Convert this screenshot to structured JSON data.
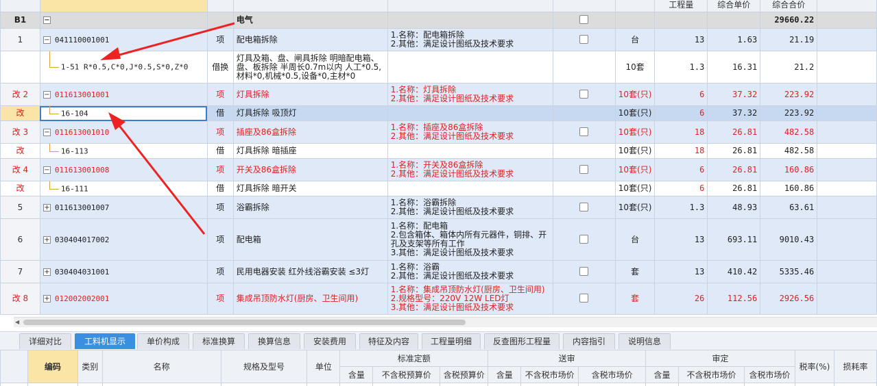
{
  "header": {
    "col_quantity": "工程量",
    "col_unit_price": "综合单价",
    "col_total_price": "综合合价"
  },
  "section": {
    "no": "B1",
    "name": "电气",
    "total": "29660.22"
  },
  "rows": [
    {
      "idx": "1",
      "code": "041110001001",
      "type": "项",
      "name": "配电箱拆除",
      "spec": [
        "1.名称：配电箱拆除",
        "2.其他：满足设计图纸及技术要求"
      ],
      "unit": "台",
      "qty": "13",
      "price": "1.63",
      "total": "21.19"
    },
    {
      "code": "1-51 R*0.5,C*0,J*0.5,S*0,Z*0",
      "type": "借换",
      "name": "灯具及箱、盘、闸具拆除 明暗配电箱、盘、板拆除 半周长0.7m以内  人工*0.5, 材料*0,机械*0.5,设备*0,主材*0",
      "unit": "10套",
      "qty": "1.3",
      "price": "16.31",
      "total": "21.2"
    },
    {
      "idx": "改 2",
      "code": "011613001001",
      "type": "项",
      "name": "灯具拆除",
      "spec": [
        "1.名称：灯具拆除",
        "2.其他：满足设计图纸及技术要求"
      ],
      "unit": "10套(只)",
      "qty": "6",
      "price": "37.32",
      "total": "223.92"
    },
    {
      "idx": "改",
      "code": "16-104",
      "type": "借",
      "name": "灯具拆除 吸顶灯",
      "unit": "10套(只)",
      "qty": "6",
      "price": "37.32",
      "total": "223.92"
    },
    {
      "idx": "改 3",
      "code": "011613001010",
      "type": "项",
      "name": "插座及86盒拆除",
      "spec": [
        "1.名称：插座及86盒拆除",
        "2.其他：满足设计图纸及技术要求"
      ],
      "unit": "10套(只)",
      "qty": "18",
      "price": "26.81",
      "total": "482.58"
    },
    {
      "idx": "改",
      "code": "16-113",
      "type": "借",
      "name": "灯具拆除 暗插座",
      "unit": "10套(只)",
      "qty": "18",
      "price": "26.81",
      "total": "482.58"
    },
    {
      "idx": "改 4",
      "code": "011613001008",
      "type": "项",
      "name": "开关及86盒拆除",
      "spec": [
        "1.名称：开关及86盒拆除",
        "2.其他：满足设计图纸及技术要求"
      ],
      "unit": "10套(只)",
      "qty": "6",
      "price": "26.81",
      "total": "160.86"
    },
    {
      "idx": "改",
      "code": "16-111",
      "type": "借",
      "name": "灯具拆除 暗开关",
      "unit": "10套(只)",
      "qty": "6",
      "price": "26.81",
      "total": "160.86"
    },
    {
      "idx": "5",
      "code": "011613001007",
      "type": "项",
      "name": "浴霸拆除",
      "spec": [
        "1.名称：浴霸拆除",
        "2.其他：满足设计图纸及技术要求"
      ],
      "unit": "10套(只)",
      "qty": "1.3",
      "price": "48.93",
      "total": "63.61"
    },
    {
      "idx": "6",
      "code": "030404017002",
      "type": "项",
      "name": "配电箱",
      "spec": [
        "1.名称：配电箱",
        "2.包含箱体、箱体内所有元器件，铜排、开孔及支架等所有工作",
        "3.其他：满足设计图纸及技术要求"
      ],
      "unit": "台",
      "qty": "13",
      "price": "693.11",
      "total": "9010.43"
    },
    {
      "idx": "7",
      "code": "030404031001",
      "type": "项",
      "name": "民用电器安装 红外线浴霸安装 ≤3灯",
      "spec": [
        "1.名称：浴霸",
        "2.其他：满足设计图纸及技术要求"
      ],
      "unit": "套",
      "qty": "13",
      "price": "410.42",
      "total": "5335.46"
    },
    {
      "idx": "改 8",
      "code": "012002002001",
      "type": "项",
      "name": "集成吊顶防水灯(厨房、卫生间用)",
      "spec": [
        "1.名称：集成吊顶防水灯(厨房、卫生间用)",
        "2.规格型号：220V 12W LED灯",
        "3.其他：满足设计图纸及技术要求"
      ],
      "unit": "套",
      "qty": "26",
      "price": "112.56",
      "total": "2926.56"
    }
  ],
  "tabs": [
    "详细对比",
    "工料机显示",
    "单价构成",
    "标准换算",
    "换算信息",
    "安装费用",
    "特征及内容",
    "工程量明细",
    "反查图形工程量",
    "内容指引",
    "说明信息"
  ],
  "active_tab": "工料机显示",
  "bottom": {
    "code": "编码",
    "category": "类别",
    "name": "名称",
    "spec": "规格及型号",
    "unit": "单位",
    "g1": "标准定额",
    "g2": "送审",
    "g3": "审定",
    "qty": "含量",
    "ex_budget": "不含税预算价",
    "in_budget": "含税预算价",
    "ex_market": "不含税市场价",
    "in_market": "含税市场价",
    "tax": "税率(%)",
    "loss": "损耗率"
  },
  "colors": {
    "accent": "#3b8fe0",
    "modified_text": "#e02020",
    "row_blue": "#dfe9f7",
    "arrow": "#ee2222"
  }
}
